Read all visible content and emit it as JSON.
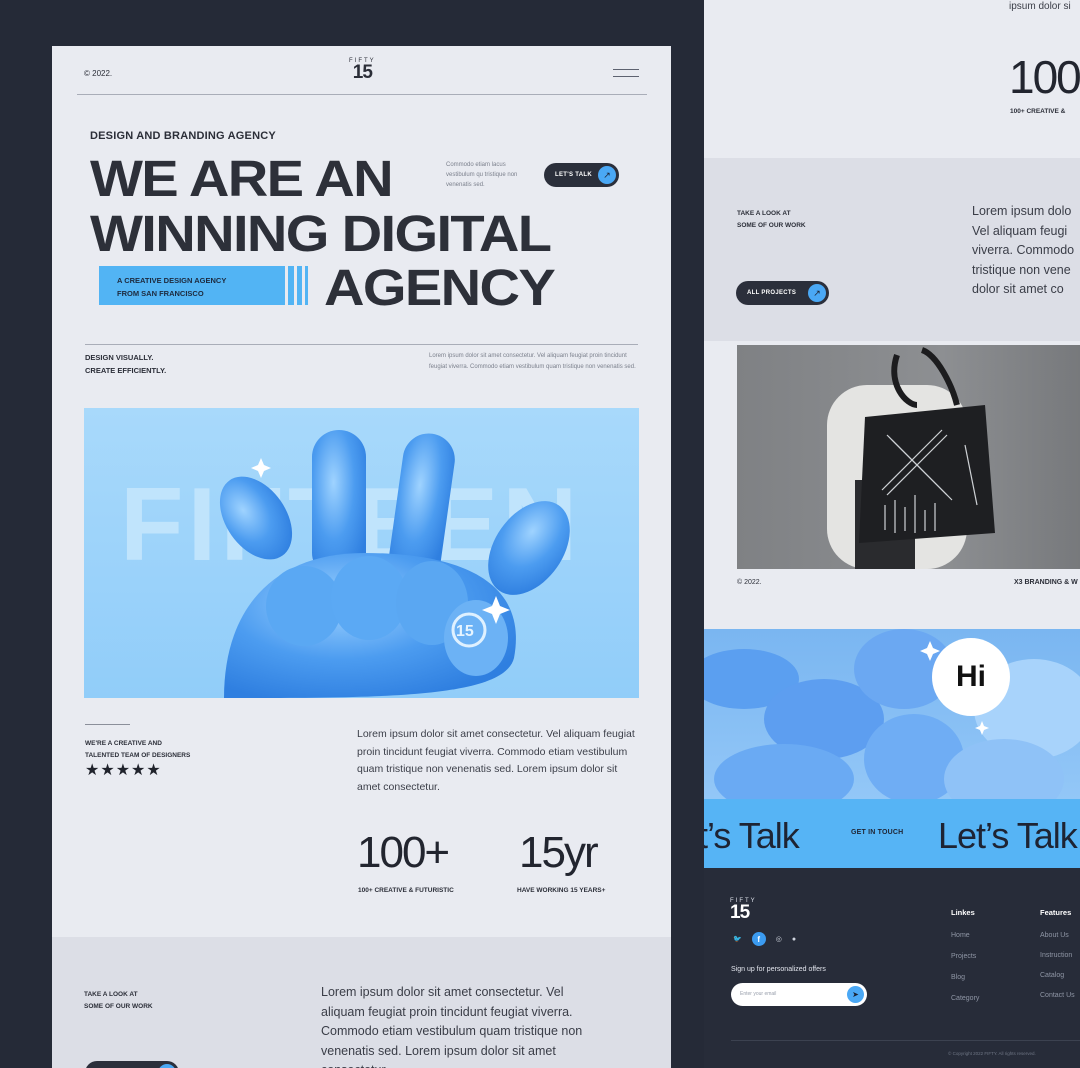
{
  "left_page": {
    "header": {
      "copyright": "© 2022.",
      "logo_top": "FIFTY",
      "logo_bottom": "15"
    },
    "hero": {
      "kicker": "DESIGN AND BRANDING AGENCY",
      "line1": "WE ARE AN",
      "line2": "WINNING DIGITAL",
      "line3": "AGENCY",
      "note": "Commodo etiam lacus vestibulum qu tristique non venenatis sed.",
      "cta_label": "LET'S TALK",
      "tag_line1": "A CREATIVE DESIGN AGENCY",
      "tag_line2": "FROM SAN FRANCISCO"
    },
    "intro": {
      "tagline1": "DESIGN VISUALLY.",
      "tagline2": "CREATE EFFICIENTLY.",
      "body": "Lorem ipsum dolor sit amet consectetur. Vel aliquam feugiat proin tincidunt feugiat viverra. Commodo etiam vestibulum quam tristique non venenatis sed."
    },
    "image": {
      "watermark": "FIFTEEN",
      "ring_label": "15"
    },
    "about": {
      "label1": "WE'RE A CREATIVE AND",
      "label2": "TALENTED TEAM OF DESIGNERS",
      "stars": "★★★★★",
      "rating": 5,
      "body": "Lorem ipsum dolor sit amet consectetur. Vel aliquam feugiat proin tincidunt feugiat viverra. Commodo etiam vestibulum quam tristique non venenatis sed. Lorem ipsum dolor sit amet consectetur."
    },
    "stats": [
      {
        "value": "100+",
        "label": "100+ CREATIVE & FUTURISTIC"
      },
      {
        "value": "15yr",
        "label": "HAVE WORKING 15 YEARS+"
      }
    ],
    "work": {
      "label1": "TAKE A LOOK AT",
      "label2": "SOME OF OUR WORK",
      "body": "Lorem ipsum dolor sit amet consectetur. Vel aliquam feugiat proin tincidunt feugiat viverra. Commodo etiam vestibulum quam tristique non venenatis sed. Lorem ipsum dolor sit amet consectetur."
    }
  },
  "right_page": {
    "top": {
      "ipsum": "ipsum dolor si",
      "stat_value": "100",
      "stat_label": "100+ CREATIVE &"
    },
    "work": {
      "label1": "TAKE A LOOK AT",
      "label2": "SOME OF OUR WORK",
      "para": [
        "Lorem ipsum dolo",
        "Vel aliquam feugi",
        "viverra. Commodo",
        "tristique non vene",
        "dolor sit amet co"
      ],
      "button_label": "ALL PROJECTS"
    },
    "photo": {
      "copyright": "© 2022.",
      "caption": "X3 BRANDING & W"
    },
    "hi": {
      "bubble": "Hi"
    },
    "talk": {
      "left": "t’s Talk",
      "middle": "GET IN TOUCH",
      "right": "Let’s Talk"
    },
    "footer": {
      "logo_top": "FIFTY",
      "logo_bottom": "15",
      "socials": [
        "twitter-icon",
        "facebook-icon",
        "instagram-icon",
        "github-icon"
      ],
      "signup": "Sign up for personalized offers",
      "email_placeholder": "Enter your email",
      "links_title": "Linkes",
      "links": [
        "Home",
        "Projects",
        "Blog",
        "Category"
      ],
      "features_title": "Features",
      "features": [
        "About Us",
        "Instruction",
        "Catalog",
        "Contact Us"
      ],
      "copyright": "© Copyright 2022 FIFTY. All rights reserved."
    }
  },
  "colors": {
    "accent": "#52b4f4",
    "dark": "#252a37",
    "light": "#e9ebf1"
  }
}
